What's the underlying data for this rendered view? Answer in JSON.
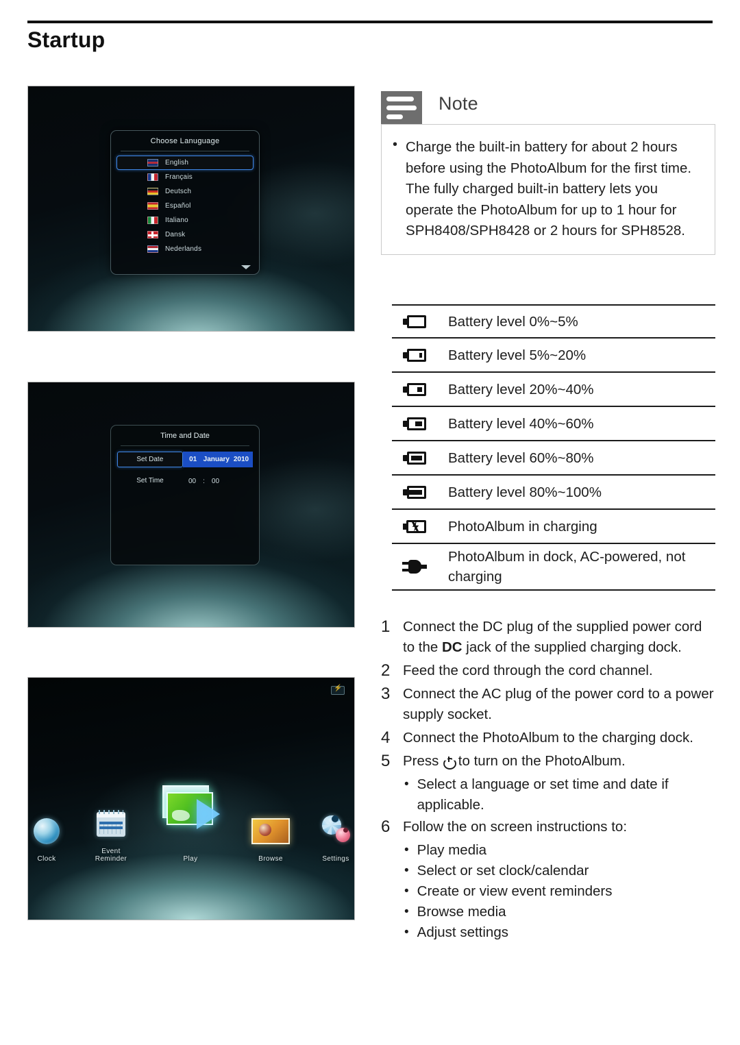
{
  "page": {
    "title": "Startup"
  },
  "note": {
    "label": "Note",
    "bullet": "•",
    "items": [
      "Charge the built-in battery for about 2 hours before using the PhotoAlbum for the first time. The fully charged built-in battery lets you operate the PhotoAlbum for up to 1 hour for SPH8408/SPH8428 or 2 hours for SPH8528."
    ]
  },
  "battery_table": {
    "rows": [
      {
        "icon": "battery-empty-icon",
        "fill": 0,
        "label": "Battery level 0%~5%"
      },
      {
        "icon": "battery-low-icon",
        "fill": 22,
        "label": "Battery level 5%~20%"
      },
      {
        "icon": "battery-quarter-icon",
        "fill": 38,
        "label": "Battery level 20%~40%"
      },
      {
        "icon": "battery-half-icon",
        "fill": 50,
        "label": "Battery level 40%~60%"
      },
      {
        "icon": "battery-high-icon",
        "fill": 74,
        "label": "Battery level 60%~80%"
      },
      {
        "icon": "battery-full-icon",
        "fill": 100,
        "label": "Battery level 80%~100%"
      },
      {
        "icon": "battery-charging-icon",
        "fill": -1,
        "label": "PhotoAlbum in charging"
      },
      {
        "icon": "ac-plug-icon",
        "fill": -1,
        "label": "PhotoAlbum in dock, AC-powered, not charging"
      }
    ]
  },
  "steps": [
    {
      "num": "1",
      "text_before": "Connect the DC plug of the supplied power cord to the ",
      "bold": "DC",
      "text_after": " jack of the supplied charging dock.",
      "sub": []
    },
    {
      "num": "2",
      "text_before": "Feed the cord through the cord channel.",
      "bold": "",
      "text_after": "",
      "sub": []
    },
    {
      "num": "3",
      "text_before": "Connect the AC plug of the power cord to a power supply socket.",
      "bold": "",
      "text_after": "",
      "sub": []
    },
    {
      "num": "4",
      "text_before": "Connect the PhotoAlbum to the charging dock.",
      "bold": "",
      "text_after": "",
      "sub": []
    },
    {
      "num": "5",
      "text_before": "Press ",
      "bold": "",
      "text_after": " to turn on the PhotoAlbum.",
      "power_icon": true,
      "sub": [
        "Select a language or set time and date if applicable."
      ]
    },
    {
      "num": "6",
      "text_before": "Follow the on screen instructions to:",
      "bold": "",
      "text_after": "",
      "sub": [
        "Play media",
        "Select or set clock/calendar",
        "Create or view event reminders",
        "Browse media",
        "Adjust settings"
      ]
    }
  ],
  "sub_bullet": "•",
  "screenshot_language": {
    "dialog_title": "Choose Lanuguage",
    "selected": "English",
    "options": [
      {
        "label": "English",
        "flag": "flag-uk"
      },
      {
        "label": "Français",
        "flag": "flag-fr"
      },
      {
        "label": "Deutsch",
        "flag": "flag-de"
      },
      {
        "label": "Español",
        "flag": "flag-es"
      },
      {
        "label": "Italiano",
        "flag": "flag-it"
      },
      {
        "label": "Dansk",
        "flag": "flag-dk"
      },
      {
        "label": "Nederlands",
        "flag": "flag-nl"
      }
    ],
    "scroll_arrow": "chevron-down-icon"
  },
  "screenshot_timedate": {
    "dialog_title": "Time and Date",
    "rows": [
      {
        "key": "Set Date",
        "selected": true,
        "v1": "01",
        "v2": "January",
        "v3": "2010"
      },
      {
        "key": "Set Time",
        "selected": false,
        "v1": "00",
        "v2": ":",
        "v3": "00"
      }
    ]
  },
  "screenshot_home": {
    "status_icon": "battery-charging-icon",
    "items": [
      {
        "label": "Clock",
        "icon": "globe-icon"
      },
      {
        "label": "Event Reminder",
        "icon": "calendar-icon"
      },
      {
        "label": "Play",
        "icon": "photo-play-icon"
      },
      {
        "label": "Browse",
        "icon": "photo-browse-icon"
      },
      {
        "label": "Settings",
        "icon": "gears-icon"
      }
    ]
  }
}
